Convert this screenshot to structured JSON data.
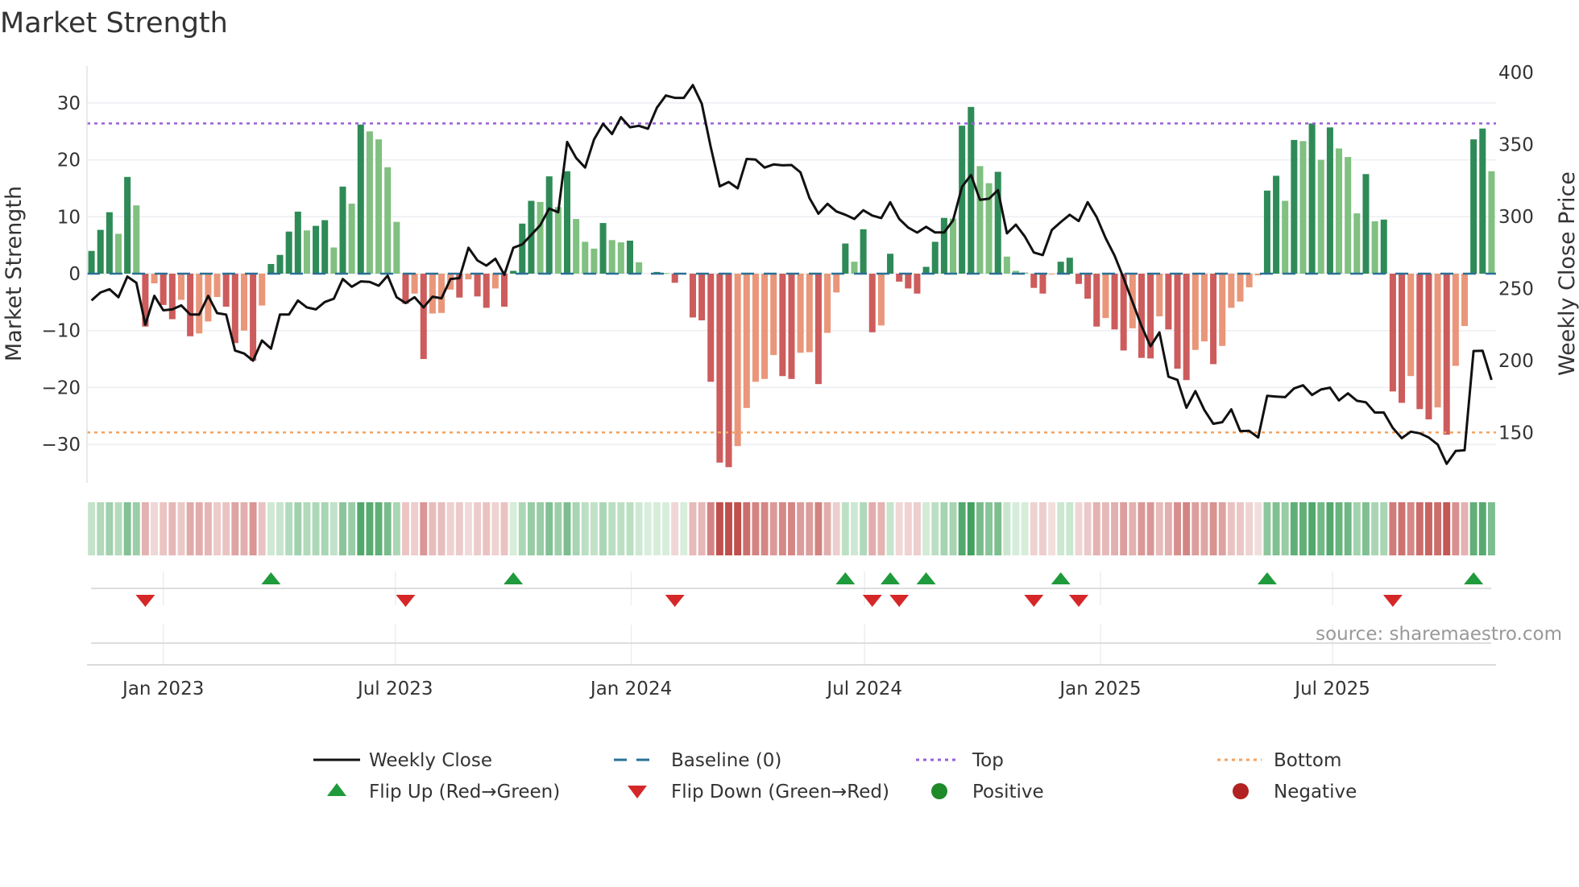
{
  "chart_data": {
    "type": "bar",
    "title": "Market Strength",
    "ylabel": "Market Strength",
    "y2label": "Weekly Close Price",
    "ylim": [
      -36.8,
      36.5
    ],
    "y2lim": [
      115,
      404.5
    ],
    "yticks": [
      30,
      20,
      10,
      0,
      -10,
      -20,
      -30
    ],
    "y2ticks": [
      400,
      350,
      300,
      250,
      200,
      150
    ],
    "x_start_week": "2022-11-06",
    "x_interval_days": 7,
    "xticks": [
      {
        "date": "2023-01-01",
        "label": "Jan 2023"
      },
      {
        "date": "2023-07-01",
        "label": "Jul 2023"
      },
      {
        "date": "2024-01-01",
        "label": "Jan 2024"
      },
      {
        "date": "2024-07-01",
        "label": "Jul 2024"
      },
      {
        "date": "2025-01-01",
        "label": "Jan 2025"
      },
      {
        "date": "2025-07-01",
        "label": "Jul 2025"
      }
    ],
    "top_level": 26.4,
    "bottom_level": -27.9,
    "baseline": 0,
    "grid": true,
    "legend_placement": "bottom",
    "strength": [
      4,
      7.7,
      10.8,
      7,
      17,
      12,
      -9.3,
      -1.7,
      -5.5,
      -8,
      -4.6,
      -11,
      -10.5,
      -8.4,
      -4.1,
      -5.8,
      -12.2,
      -10,
      -15.3,
      -5.6,
      1.7,
      3.3,
      7.4,
      10.9,
      7.6,
      8.4,
      9.4,
      4.6,
      15.3,
      12.3,
      26.2,
      25,
      23.6,
      18.7,
      9.1,
      -5.3,
      -3.5,
      -15,
      -7,
      -6.9,
      -2.8,
      -4.2,
      -1,
      -4,
      -6,
      -2.6,
      -5.8,
      0.5,
      8.8,
      12.8,
      12.6,
      17.1,
      11.7,
      18,
      9.6,
      5.6,
      4.4,
      8.9,
      5.9,
      5.5,
      5.8,
      2,
      0,
      0.3,
      0.1,
      -1.6,
      0,
      -7.7,
      -8.2,
      -19,
      -33.2,
      -34,
      -30.3,
      -23.6,
      -19,
      -18.5,
      -14.3,
      -18,
      -18.5,
      -13.9,
      -13.8,
      -19.4,
      -10.4,
      -3.3,
      5.3,
      2.1,
      7.8,
      -10.3,
      -9.1,
      3.5,
      -1.4,
      -2.6,
      -3.5,
      1.2,
      5.6,
      9.8,
      9.7,
      26,
      29.3,
      18.9,
      15.9,
      17.9,
      3,
      0.5,
      0.2,
      -2.5,
      -3.5,
      -0.1,
      2.1,
      2.8,
      -1.8,
      -4.4,
      -9.3,
      -7.8,
      -9.8,
      -13.5,
      -9.6,
      -14.8,
      -14.9,
      -7.5,
      -9.8,
      -16.7,
      -18.7,
      -13.4,
      -11.9,
      -15.9,
      -12.7,
      -6,
      -4.9,
      -2.4,
      -0.3,
      14.6,
      17.2,
      12.8,
      23.5,
      23.3,
      26.4,
      20,
      25.7,
      22,
      20.5,
      10.6,
      17.5,
      9.2,
      9.5,
      -20.7,
      -22.7,
      -18,
      -23.8,
      -25.6,
      -23.5,
      -28.3,
      -16.2,
      -9.2,
      23.6,
      25.5,
      18
    ],
    "weekly_close": [
      241.8,
      247.3,
      249.6,
      244,
      258.4,
      254,
      225,
      245,
      235,
      235.6,
      238.4,
      232,
      232,
      245,
      233,
      232,
      207,
      205,
      200,
      214,
      208.4,
      232,
      232,
      241.8,
      237,
      235.6,
      240.7,
      243,
      256.7,
      251.3,
      255,
      254.7,
      252,
      259,
      244,
      240,
      244,
      237,
      244.4,
      243.3,
      256.7,
      257.3,
      278.4,
      269.6,
      266,
      270.7,
      259.6,
      278.4,
      280.7,
      287.3,
      294,
      305.6,
      303,
      351.8,
      340.7,
      334,
      353.6,
      364.4,
      357.3,
      369,
      362,
      363,
      361,
      375.6,
      384,
      382.4,
      382.4,
      391.3,
      378.4,
      348.4,
      321,
      324,
      319.6,
      340,
      339.6,
      334,
      336.2,
      335.6,
      335.8,
      330.7,
      312.9,
      302,
      308.9,
      303.6,
      301.3,
      298.4,
      304.4,
      300.7,
      299,
      310,
      298.4,
      292.4,
      288.9,
      292.9,
      289,
      289,
      297.3,
      320.7,
      328.9,
      311.6,
      312.4,
      318.4,
      288.4,
      294.4,
      286.2,
      275.1,
      273.3,
      290.7,
      296.2,
      301.3,
      296.9,
      310,
      299.6,
      285.1,
      272.9,
      257.3,
      240.7,
      224,
      210,
      219.6,
      188.9,
      186.7,
      167.3,
      178.9,
      165.8,
      156.2,
      157.3,
      166.2,
      151.1,
      151.3,
      146.7,
      175.6,
      175.1,
      174.7,
      180.7,
      182.9,
      176.2,
      180,
      181.3,
      172.4,
      177.3,
      172.2,
      171.1,
      164,
      164,
      153.3,
      146.2,
      150.7,
      149.6,
      146.7,
      141.8,
      128.4,
      137.3,
      137.8,
      206.7,
      206.9,
      186.7
    ],
    "legend": [
      {
        "key": "weekly_close",
        "label": "Weekly Close"
      },
      {
        "key": "baseline",
        "label": "Baseline (0)"
      },
      {
        "key": "top",
        "label": "Top"
      },
      {
        "key": "bottom",
        "label": "Bottom"
      },
      {
        "key": "flip_up",
        "label": "Flip Up (Red→Green)"
      },
      {
        "key": "flip_down",
        "label": "Flip Down (Green→Red)"
      },
      {
        "key": "positive",
        "label": "Positive"
      },
      {
        "key": "negative",
        "label": "Negative"
      }
    ],
    "source": "source: sharemaestro.com"
  },
  "colors": {
    "pos_strong": "#2e8b57",
    "pos_weak": "#80c080",
    "neg_strong": "#cd5c5c",
    "neg_weak": "#e9967a",
    "line": "#111111",
    "baseline": "#2a7096",
    "top": "#9b5fd8",
    "bottom": "#f4a35f",
    "flip_up": "#1f9a3c",
    "flip_down": "#d62728",
    "positive": "#1f8a2a",
    "negative": "#b22222"
  }
}
